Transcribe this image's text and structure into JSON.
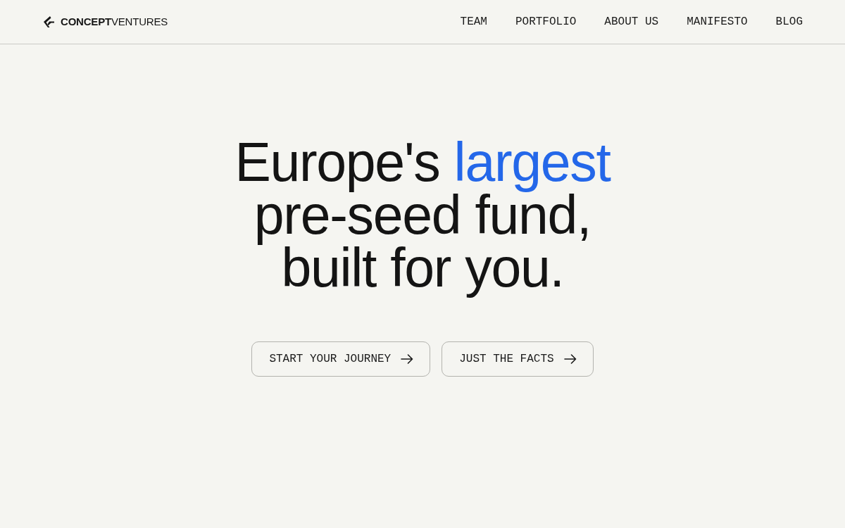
{
  "header": {
    "brand": "**CONCEPT**VENTURES",
    "nav": [
      {
        "label": "TEAM"
      },
      {
        "label": "PORTFOLIO"
      },
      {
        "label": "ABOUT US"
      },
      {
        "label": "MANIFESTO"
      },
      {
        "label": "BLOG"
      }
    ]
  },
  "hero": {
    "headline_lines": [
      [
        {
          "text": "Europe's ",
          "highlight": false
        },
        {
          "text": "largest",
          "highlight": true
        }
      ],
      [
        {
          "text": "pre-seed fund,",
          "highlight": false
        }
      ],
      [
        {
          "text": "built for you.",
          "highlight": false
        }
      ]
    ],
    "buttons": [
      {
        "label": "START YOUR JOURNEY"
      },
      {
        "label": "JUST THE FACTS"
      }
    ]
  }
}
